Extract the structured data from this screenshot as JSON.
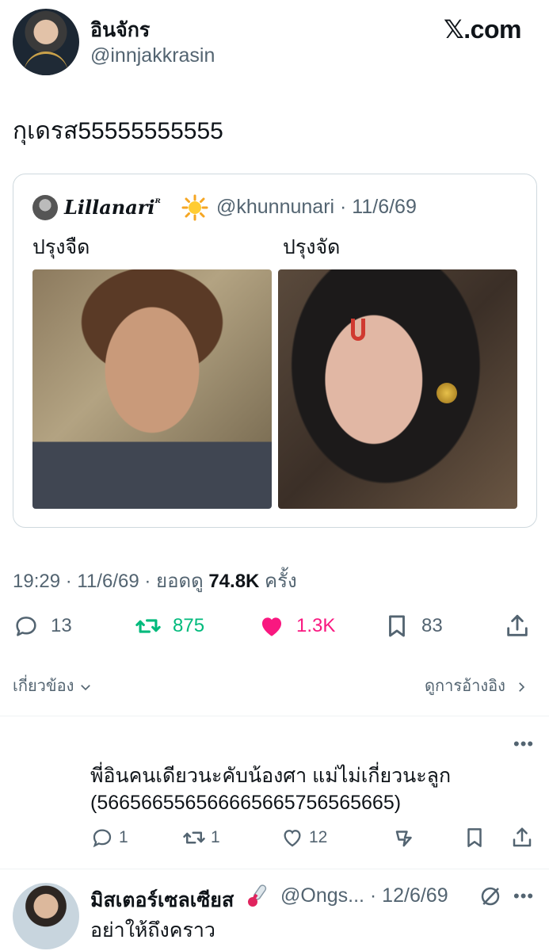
{
  "author": {
    "name": "อินจักร",
    "handle": "@innjakkrasin"
  },
  "brand": {
    "x_glyph": "𝕏",
    "suffix": ".com"
  },
  "tweet": {
    "text": "กุเดรส55555555555"
  },
  "quote": {
    "name": "Lillanari",
    "name_mark": "ᴿ",
    "handle_date": "@khunnunari · 11/6/69",
    "left_label": "ปรุงจืด",
    "right_label": "ปรุงจัด"
  },
  "meta": {
    "time_date": "19:29 · 11/6/69 · ยอดดู ",
    "views": "74.8K",
    "views_suffix": " ครั้ง"
  },
  "actions": {
    "replies": "13",
    "reposts": "875",
    "likes": "1.3K",
    "bookmarks": "83"
  },
  "colors": {
    "repost": "#00ba7c",
    "like": "#f91880",
    "muted": "#536471"
  },
  "links": {
    "related": "เกี่ยวข้อง",
    "view_quotes": "ดูการอ้างอิง"
  },
  "reply1": {
    "text_line1": "พี่อินคนเดียวนะคับน้องศา แม่ไม่เกี่ยวนะลูก",
    "text_line2": "(566566556566665665756565665)",
    "replies": "1",
    "reposts": "1",
    "likes": "12"
  },
  "reply2": {
    "name": "มิสเตอร์เซลเซียส",
    "handle_date": "@Ongs... · 12/6/69",
    "text": "อย่าให้ถึงคราว"
  },
  "icons": [
    "reply-icon",
    "repost-icon",
    "heart-icon",
    "bookmark-icon",
    "share-icon",
    "chevron-down-icon",
    "chevron-right-icon",
    "more-icon",
    "analytics-icon",
    "grok-icon",
    "sun-icon",
    "thermometer-icon"
  ]
}
